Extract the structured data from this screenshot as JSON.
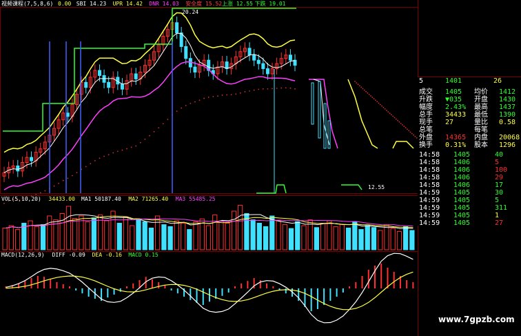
{
  "colors": {
    "background": "#000000",
    "grid": "#7a0000",
    "up": "#ff3030",
    "down": "#40e0ff",
    "ma_yellow": "#ffff40",
    "ma_magenta": "#ff40ff",
    "ma_white": "#ffffff",
    "green": "#30ff30",
    "dotted_red": "#d03030"
  },
  "header": {
    "title": "视频课程(7,5,8,6)",
    "items": [
      {
        "label": "0.00",
        "color": "#ffff40"
      },
      {
        "label": "SBI 14.23",
        "color": "#ffffff"
      },
      {
        "label": "UPR 14.42",
        "color": "#ffff40"
      },
      {
        "label": "DNR 14.03",
        "color": "#ff40ff"
      },
      {
        "label": "安全度 15.52",
        "color": "#ff4040"
      },
      {
        "label": "上涨 12.55",
        "color": "#30ff30"
      },
      {
        "label": "下跌 19.01",
        "color": "#30ff30"
      }
    ]
  },
  "annotations": {
    "high_price": "20.24",
    "low_mark": "12.55"
  },
  "vol_header": {
    "items": [
      {
        "label": "VOL(5,10,20)",
        "color": "#ffffff"
      },
      {
        "label": "34433.00",
        "color": "#ffff40"
      },
      {
        "label": "MA1 50187.40",
        "color": "#ffffff"
      },
      {
        "label": "MA2 71265.40",
        "color": "#ffff40"
      },
      {
        "label": "MA3 55485.25",
        "color": "#ff40ff"
      }
    ]
  },
  "macd_header": {
    "items": [
      {
        "label": "MACD(12,26,9)",
        "color": "#ffffff"
      },
      {
        "label": "DIFF -0.09",
        "color": "#ffffff"
      },
      {
        "label": "DEA -0.16",
        "color": "#ffff40"
      },
      {
        "label": "MACD 0.15",
        "color": "#30ff30"
      }
    ]
  },
  "quote_panel": {
    "top_line": {
      "a": "5",
      "b": "1401",
      "c": "26"
    },
    "rows": [
      {
        "label": "成交",
        "value": "1405",
        "label2": "均价",
        "value2": "1412",
        "vcolor": "#30ff30",
        "v2color": "#30ff30"
      },
      {
        "label": "升跌",
        "value": "▼035",
        "label2": "开盘",
        "value2": "1430",
        "vcolor": "#30ff30",
        "v2color": "#30ff30"
      },
      {
        "label": "幅度",
        "value": "2.43%",
        "label2": "最高",
        "value2": "1437",
        "vcolor": "#30ff30",
        "v2color": "#30ff30"
      },
      {
        "label": "总手",
        "value": "34433",
        "label2": "最低",
        "value2": "1390",
        "vcolor": "#ffff40",
        "v2color": "#30ff30"
      },
      {
        "label": "现手",
        "value": "27",
        "label2": "量比",
        "value2": "0.58",
        "vcolor": "#ffff40",
        "v2color": "#ffff40"
      },
      {
        "label": "总笔",
        "value": "",
        "label2": "每笔",
        "value2": "",
        "vcolor": "#ffffff",
        "v2color": "#ffffff"
      },
      {
        "label": "外盘",
        "value": "14365",
        "label2": "内盘",
        "value2": "20068",
        "vcolor": "#ff3030",
        "v2color": "#ffff40"
      },
      {
        "label": "换手",
        "value": "0.31%",
        "label2": "股本",
        "value2": "1296",
        "vcolor": "#ffff40",
        "v2color": "#ffff40"
      }
    ],
    "ticks": [
      {
        "time": "14:58",
        "price": "1406",
        "vol": "5",
        "vcolor": "#ff3030"
      },
      {
        "time": "14:58",
        "price": "1406",
        "vol": "100",
        "vcolor": "#ff3030"
      },
      {
        "time": "14:58",
        "price": "1406",
        "vol": "29",
        "vcolor": "#ff3030"
      },
      {
        "time": "14:58",
        "price": "1406",
        "vol": "17",
        "vcolor": "#30ff30"
      },
      {
        "time": "14:59",
        "price": "1405",
        "vol": "30",
        "vcolor": "#30ff30"
      },
      {
        "time": "14:59",
        "price": "1405",
        "vol": "5",
        "vcolor": "#30ff30"
      },
      {
        "time": "14:59",
        "price": "1405",
        "vol": "311",
        "vcolor": "#30ff30"
      },
      {
        "time": "14:59",
        "price": "1405",
        "vol": "1",
        "vcolor": "#ffff40"
      },
      {
        "time": "14:59",
        "price": "1405",
        "vol": "27",
        "vcolor": "#ff3030"
      }
    ],
    "first_tick": {
      "time": "14:58",
      "price": "1405",
      "vol": "40",
      "vcolor": "#30ff30"
    }
  },
  "watermark": "www.7gpzb.com",
  "chart_data": [
    {
      "type": "candlestick",
      "title": "视频课程(7,5,8,6)",
      "xlabel": "",
      "ylabel": "",
      "ylim": [
        10,
        20.6
      ],
      "high_label": "20.24",
      "close": [
        11.2,
        11.5,
        11.6,
        11.3,
        11.8,
        12.1,
        11.9,
        12.4,
        12.6,
        13.0,
        13.4,
        13.8,
        14.3,
        14.7,
        14.5,
        15.2,
        15.8,
        16.5,
        16.2,
        16.8,
        17.2,
        16.9,
        16.5,
        16.2,
        16.8,
        16.4,
        16.1,
        16.6,
        17.0,
        16.7,
        17.1,
        17.5,
        17.8,
        18.3,
        18.7,
        19.2,
        19.6,
        20.0,
        19.4,
        18.6,
        17.9,
        17.4,
        17.1,
        17.5,
        17.8,
        17.2,
        17.0,
        17.4,
        17.7,
        17.3,
        17.6,
        18.0,
        18.3,
        18.5,
        18.1,
        17.8,
        17.6,
        17.3,
        17.0,
        17.3,
        17.6,
        17.9,
        18.1,
        17.8,
        17.5
      ],
      "vol": [
        0.45,
        0.5,
        0.42,
        0.55,
        0.6,
        0.48,
        0.52,
        0.7,
        0.62,
        0.75,
        0.9,
        0.65,
        0.7,
        0.58,
        0.66,
        0.72,
        0.6,
        0.8,
        0.55,
        0.68,
        0.5,
        0.62,
        0.58,
        0.45,
        0.7,
        0.52,
        0.48,
        0.6,
        0.55,
        0.42,
        0.58,
        0.64,
        0.5,
        0.72,
        0.6,
        0.55,
        0.8,
        0.92,
        0.75,
        0.62,
        0.55,
        0.48,
        0.7,
        0.6,
        0.52,
        0.44,
        0.58,
        0.5,
        0.62,
        0.46,
        0.55,
        0.6,
        0.48,
        0.52,
        0.45,
        0.58,
        0.42,
        0.5,
        0.46,
        0.4,
        0.52,
        0.44,
        0.38,
        0.48,
        0.4
      ],
      "macd_hist": [
        0.05,
        0.08,
        0.12,
        0.18,
        0.25,
        0.3,
        0.28,
        0.22,
        0.15,
        0.1,
        0.05,
        -0.05,
        -0.12,
        -0.2,
        -0.25,
        -0.3,
        -0.22,
        -0.15,
        -0.08,
        0.05,
        0.12,
        0.2,
        0.28,
        0.22,
        0.15,
        0.08,
        -0.05,
        -0.12,
        -0.2,
        -0.28,
        -0.35,
        -0.4,
        -0.32,
        -0.25,
        -0.18,
        -0.1,
        0.05,
        0.12,
        0.18,
        0.25,
        0.2,
        0.12,
        0.05,
        -0.05,
        -0.12,
        -0.2,
        -0.3,
        -0.45,
        -0.55,
        -0.5,
        -0.4,
        -0.3,
        -0.2,
        -0.1,
        0.05,
        0.15,
        0.3,
        0.45,
        0.55,
        0.6,
        0.5,
        0.4,
        0.3,
        0.2,
        0.15
      ]
    }
  ]
}
